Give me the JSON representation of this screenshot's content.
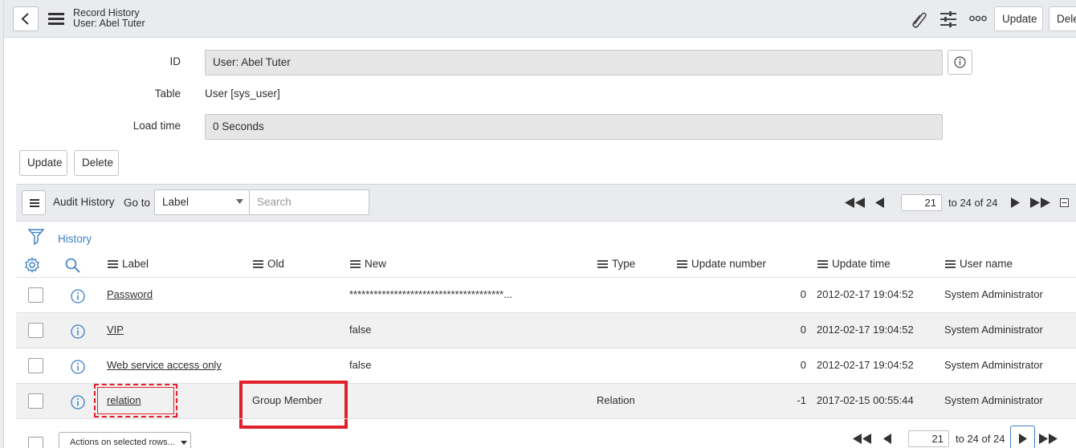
{
  "header": {
    "title": "Record History",
    "subtitle": "User: Abel Tuter",
    "update_label": "Update",
    "delete_label": "Dele"
  },
  "form": {
    "id_label": "ID",
    "id_value": "User: Abel Tuter",
    "table_label": "Table",
    "table_value": "User [sys_user]",
    "load_time_label": "Load time",
    "load_time_value": "0 Seconds",
    "update_label": "Update",
    "delete_label": "Delete"
  },
  "list_toolbar": {
    "title": "Audit History",
    "goto_label": "Go to",
    "goto_selected": "Label",
    "search_placeholder": "Search",
    "page_value": "21",
    "page_range": "to 24 of 24"
  },
  "breadcrumb": {
    "label": "History"
  },
  "columns": [
    "Label",
    "Old",
    "New",
    "Type",
    "Update number",
    "Update time",
    "User name"
  ],
  "rows": [
    {
      "label": "Password",
      "old": "",
      "new": "**************************************...",
      "type": "",
      "update_number": "0",
      "update_time": "2012-02-17 19:04:52",
      "user_name": "System Administrator"
    },
    {
      "label": "VIP",
      "old": "",
      "new": "false",
      "type": "",
      "update_number": "0",
      "update_time": "2012-02-17 19:04:52",
      "user_name": "System Administrator"
    },
    {
      "label": "Web service access only",
      "old": "",
      "new": "false",
      "type": "",
      "update_number": "0",
      "update_time": "2012-02-17 19:04:52",
      "user_name": "System Administrator"
    },
    {
      "label": "relation",
      "old": "Group Member",
      "new": "",
      "type": "Relation",
      "update_number": "-1",
      "update_time": "2017-02-15 00:55:44",
      "user_name": "System Administrator"
    }
  ],
  "footer": {
    "actions_label": "Actions on selected rows...",
    "page_value": "21",
    "page_range": "to 24 of 24"
  },
  "colors": {
    "accent_blue": "#3b7fc4",
    "highlight_red": "#e0202a"
  }
}
